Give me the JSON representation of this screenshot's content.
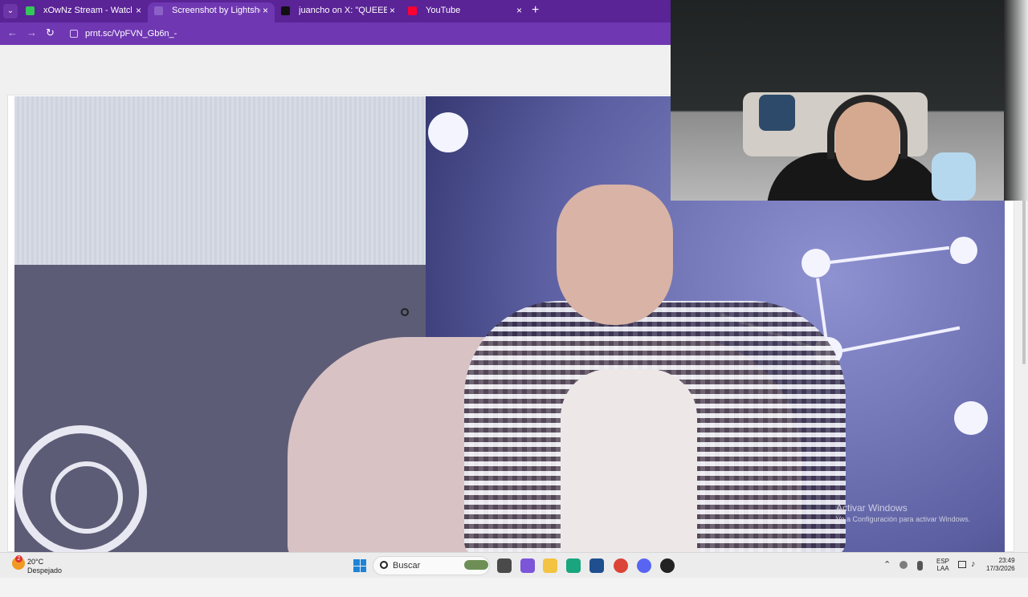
{
  "browser": {
    "tabs": [
      {
        "title": "xOwNz Stream - Watch Live on",
        "favicon_color": "#34c759",
        "active": false
      },
      {
        "title": "Screenshot by Lightshot",
        "favicon_color": "#8b61c7",
        "active": true
      },
      {
        "title": "juancho on X: \"QUEEEE https://",
        "favicon_color": "#111111",
        "active": false
      },
      {
        "title": "YouTube",
        "favicon_color": "#ff0033",
        "active": false
      }
    ],
    "tab_menu_icon": "chevron-down-icon",
    "close_symbol": "×",
    "new_tab_symbol": "+",
    "url": "prnt.sc/VpFVN_Gb6n_-",
    "back_icon": "←",
    "forward_icon": "→",
    "reload_icon": "↻"
  },
  "watermark": {
    "line1": "Activar Windows",
    "line2": "Ve a Configuración para activar Windows."
  },
  "taskbar": {
    "temperature": "20°C",
    "weather": "Despejado",
    "weather_badge": "2",
    "search_placeholder": "Buscar",
    "language": "ESP",
    "keyboard": "LAA",
    "time": "23:49",
    "date": "17/3/2026"
  }
}
